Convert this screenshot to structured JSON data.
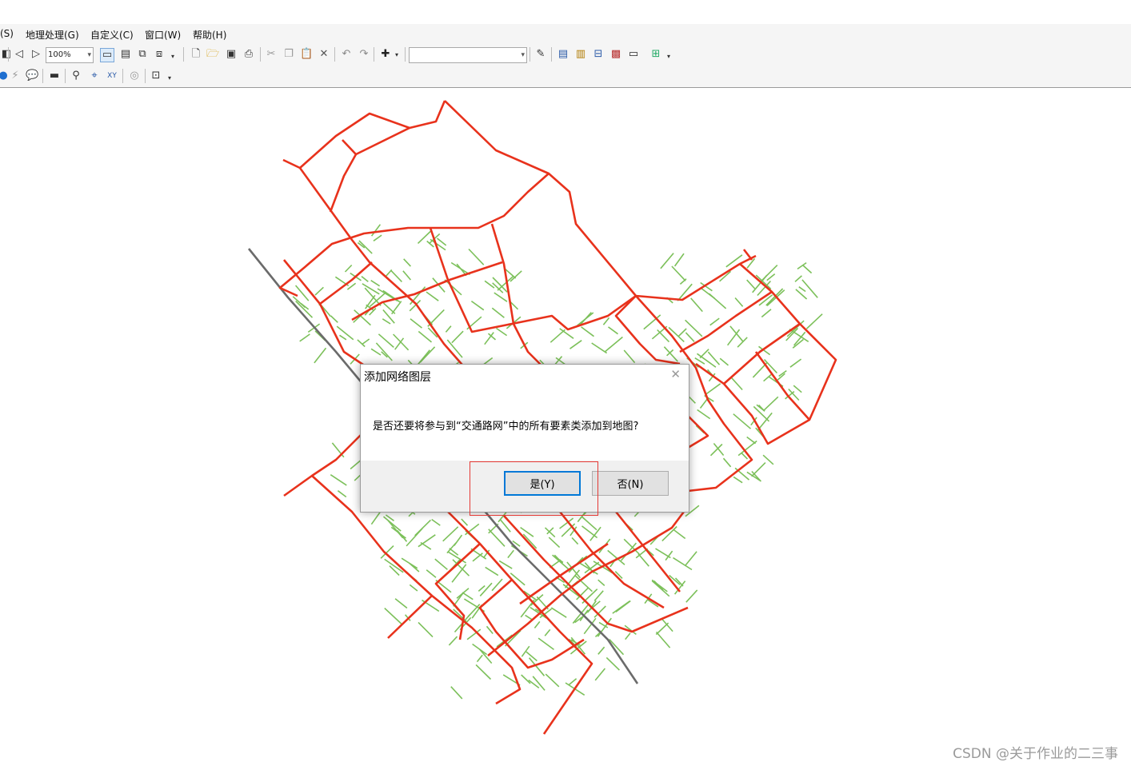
{
  "menu": {
    "items": [
      "(S)",
      "地理处理(G)",
      "自定义(C)",
      "窗口(W)",
      "帮助(H)"
    ]
  },
  "toolbar": {
    "zoom_value": "100%",
    "icons": [
      "globe-icon",
      "back-extent-icon",
      "forward-extent-icon",
      "zoom-combo",
      "pan-icon",
      "full-extent-icon",
      "new-document-icon",
      "open-icon",
      "save-icon",
      "print-icon",
      "cut-icon",
      "copy-icon",
      "paste-icon",
      "delete-icon",
      "undo-icon",
      "redo-icon",
      "add-data-icon",
      "scale-combo",
      "editor-icon",
      "table-icon",
      "catalog-icon",
      "search-icon",
      "python-icon",
      "modelbuilder-icon",
      "identify-icon",
      "find-icon",
      "go-to-xy-icon",
      "measure-icon",
      "html-popup-icon"
    ]
  },
  "map": {
    "colors": {
      "major_roads": "#e8321c",
      "minor_roads": "#7cc05a",
      "rail": "#6b6b6b"
    }
  },
  "dialog": {
    "title": "添加网络图层",
    "message": "是否还要将参与到“交通路网”中的所有要素类添加到地图?",
    "yes_label": "是(Y)",
    "no_label": "否(N)"
  },
  "watermark": "CSDN @关于作业的二三事"
}
